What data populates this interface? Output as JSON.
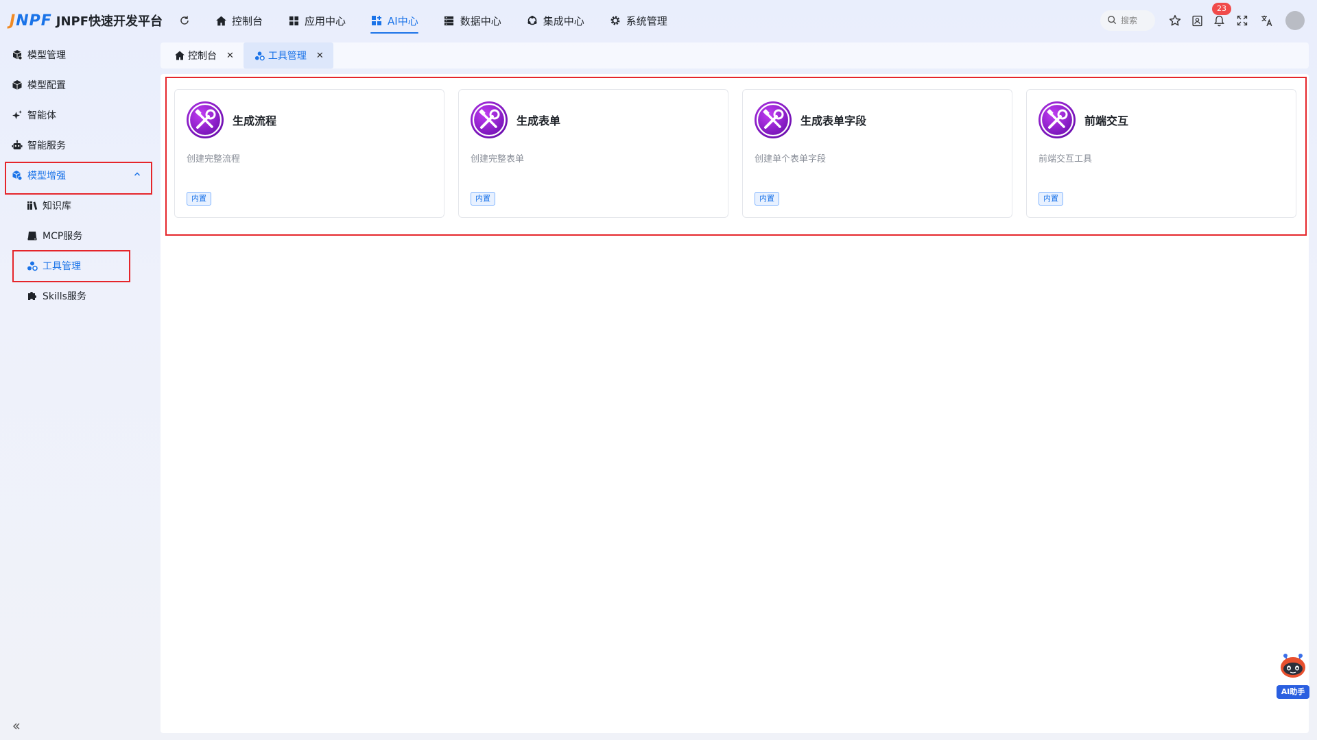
{
  "app": {
    "logo_mark_a": "J",
    "logo_mark_b": "NPF",
    "title": "JNPF快速开发平台"
  },
  "colors": {
    "accent": "#1a73e8",
    "highlight_outline": "#e5252a",
    "badge": "#f04b4b"
  },
  "nav": {
    "items": [
      {
        "label": "控制台",
        "icon": "home-icon"
      },
      {
        "label": "应用中心",
        "icon": "grid-icon"
      },
      {
        "label": "AI中心",
        "icon": "apps-plus-icon",
        "active": true
      },
      {
        "label": "数据中心",
        "icon": "database-icon"
      },
      {
        "label": "集成中心",
        "icon": "integration-icon"
      },
      {
        "label": "系统管理",
        "icon": "gear-icon"
      }
    ]
  },
  "header": {
    "search_placeholder": "搜索",
    "notification_count": "23"
  },
  "sidebar": {
    "items": [
      {
        "label": "模型管理",
        "icon": "model-cubes-icon"
      },
      {
        "label": "模型配置",
        "icon": "cube-icon"
      },
      {
        "label": "智能体",
        "icon": "sparkle-icon"
      },
      {
        "label": "智能服务",
        "icon": "robot-icon"
      },
      {
        "label": "模型增强",
        "icon": "model-enhance-icon",
        "expanded": true,
        "active": true
      },
      {
        "label": "知识库",
        "icon": "library-icon",
        "sub": true
      },
      {
        "label": "MCP服务",
        "icon": "server-icon",
        "sub": true
      },
      {
        "label": "工具管理",
        "icon": "tools-cluster-icon",
        "sub": true,
        "active": true
      },
      {
        "label": "Skills服务",
        "icon": "puzzle-icon",
        "sub": true
      }
    ]
  },
  "tabs": [
    {
      "label": "控制台",
      "icon": "home-icon"
    },
    {
      "label": "工具管理",
      "icon": "tools-cluster-icon",
      "active": true
    }
  ],
  "cards": [
    {
      "title": "生成流程",
      "desc": "创建完整流程",
      "tag": "内置"
    },
    {
      "title": "生成表单",
      "desc": "创建完整表单",
      "tag": "内置"
    },
    {
      "title": "生成表单字段",
      "desc": "创建单个表单字段",
      "tag": "内置"
    },
    {
      "title": "前端交互",
      "desc": "前端交互工具",
      "tag": "内置"
    }
  ],
  "assistant": {
    "label": "AI助手"
  }
}
